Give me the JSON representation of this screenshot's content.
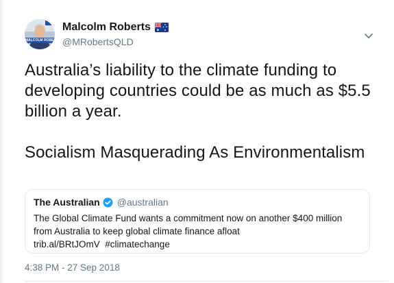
{
  "author": {
    "display_name": "Malcolm Roberts",
    "handle": "@MRobertsQLD",
    "avatar_text": "MALCOLM ROBERTS"
  },
  "tweet": {
    "paragraphs": [
      "Australia’s liability to the climate funding to developing countries could be as much as $5.5 billion a year.",
      "Socialism Masquerading As Environmentalism"
    ],
    "timestamp": "4:38 PM - 27 Sep 2018"
  },
  "quoted_tweet": {
    "display_name": "The Australian",
    "handle": "@australian",
    "text": "The Global Climate Fund wants a commitment now on another $400 million from Australia to keep global climate finance afloat",
    "link_line": "trib.al/BRtJOmV  #climatechange"
  },
  "icons": {
    "flag": "australia-flag-icon",
    "menu": "chevron-down-icon",
    "verified": "verified-badge-icon"
  },
  "colors": {
    "text_primary": "#14171a",
    "text_secondary": "#657786",
    "verified_blue": "#1da1f2",
    "border": "#e1e8ed"
  }
}
